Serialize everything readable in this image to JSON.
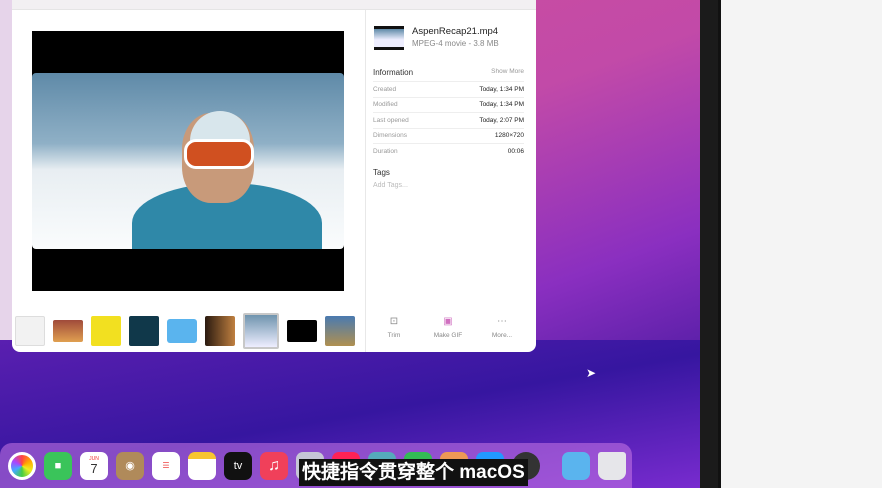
{
  "file": {
    "name": "AspenRecap21.mp4",
    "subtitle": "MPEG-4 movie - 3.8 MB"
  },
  "information": {
    "title": "Information",
    "show_more": "Show More",
    "rows": [
      {
        "key": "Created",
        "value": "Today, 1:34 PM"
      },
      {
        "key": "Modified",
        "value": "Today, 1:34 PM"
      },
      {
        "key": "Last opened",
        "value": "Today, 2:07 PM"
      },
      {
        "key": "Dimensions",
        "value": "1280×720"
      },
      {
        "key": "Duration",
        "value": "00:06"
      }
    ]
  },
  "tags": {
    "title": "Tags",
    "placeholder": "Add Tags..."
  },
  "actions": [
    {
      "label": "Trim",
      "icon": "trim-icon"
    },
    {
      "label": "Make GIF",
      "icon": "gif-icon"
    },
    {
      "label": "More...",
      "icon": "more-icon"
    }
  ],
  "dock": {
    "calendar_month": "JUN",
    "calendar_day": "7",
    "tv_label": "tv"
  },
  "subtitle": "快捷指令贯穿整个 macOS"
}
